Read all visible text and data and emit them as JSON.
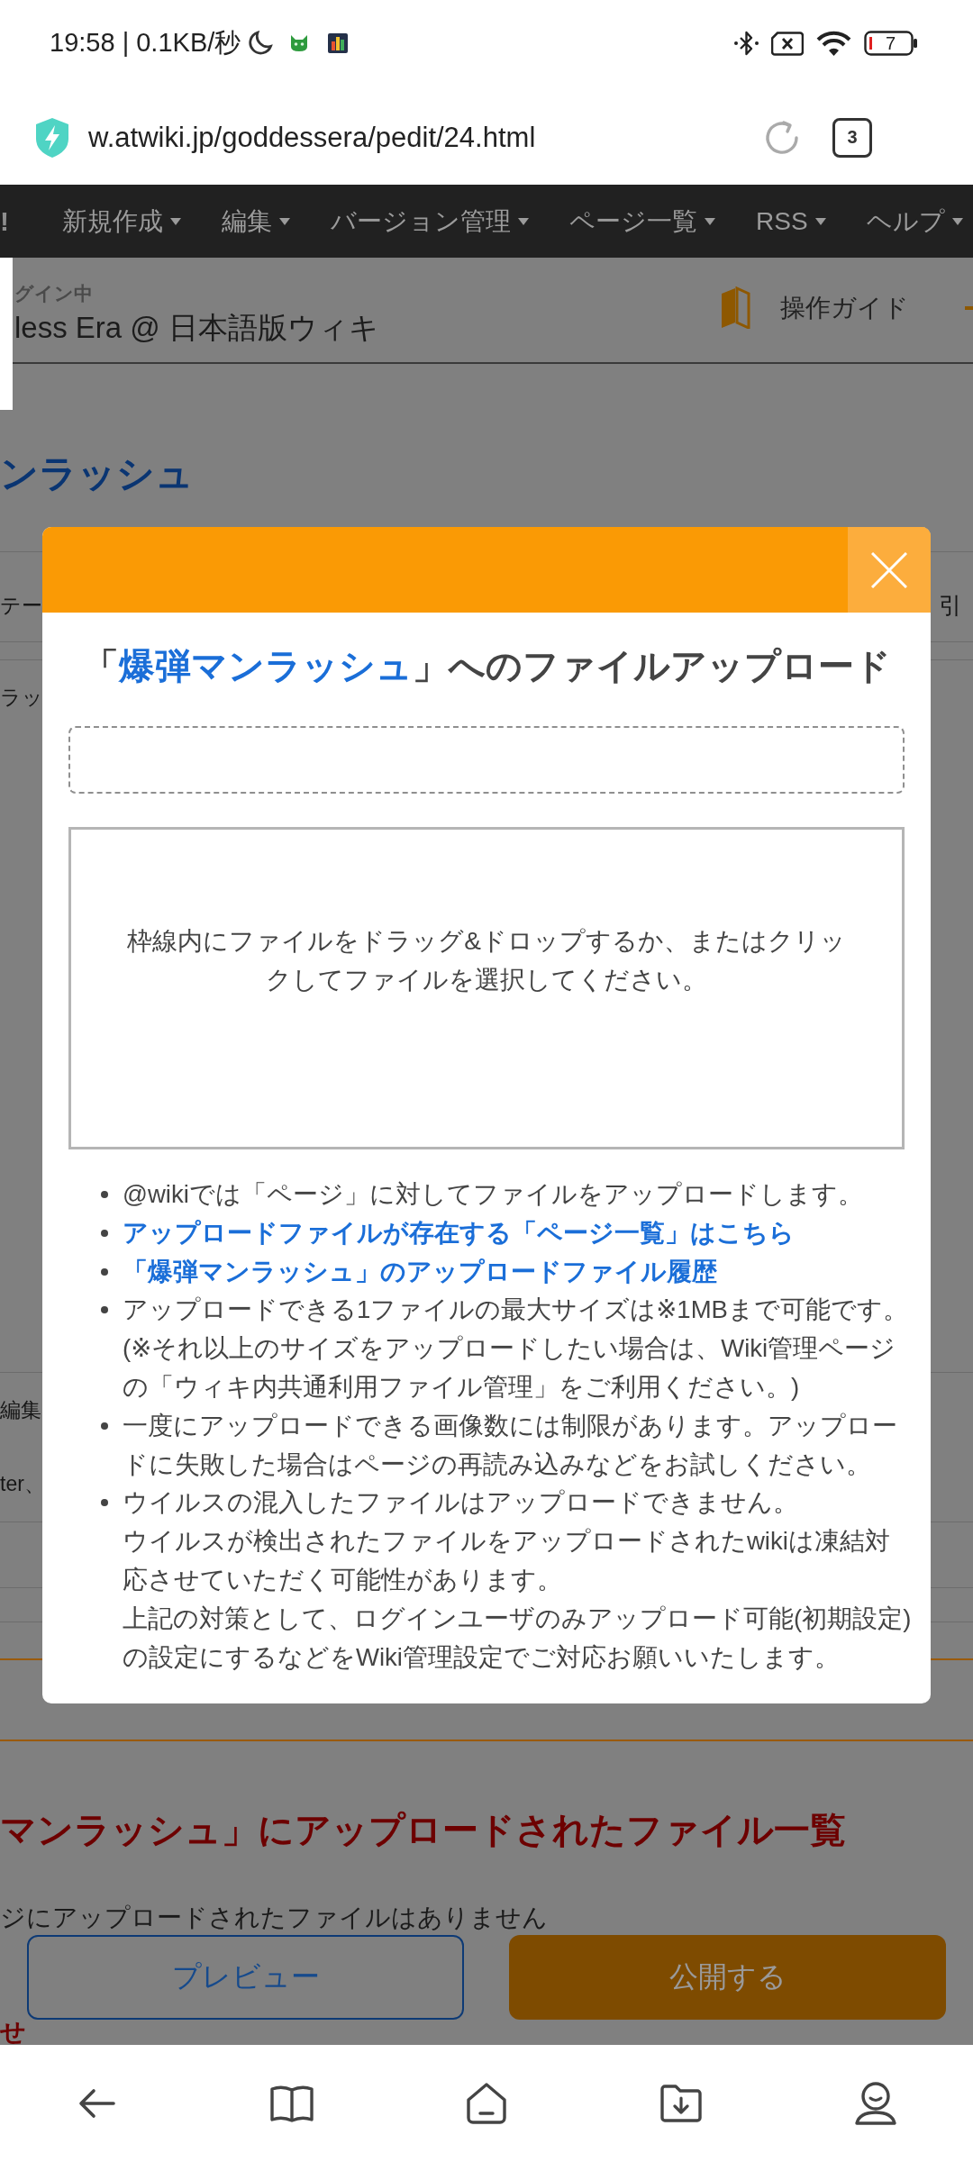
{
  "status_bar": {
    "time_speed": "19:58 | 0.1KB/秒",
    "battery": "7"
  },
  "address_bar": {
    "url": "w.atwiki.jp/goddessera/pedit/24.html",
    "tab_count": "3"
  },
  "site_nav": {
    "logo_fragment": "!",
    "items": [
      {
        "label": "新規作成"
      },
      {
        "label": "編集"
      },
      {
        "label": "バージョン管理"
      },
      {
        "label": "ページ一覧"
      },
      {
        "label": "RSS"
      },
      {
        "label": "ヘルプ"
      }
    ]
  },
  "background_page": {
    "header": {
      "login_status": "グイン中",
      "site_title": "less Era @ 日本語版ウィキ",
      "guide_link": "操作ガイド"
    },
    "page_title": "ンラッシュ",
    "tab_row": {
      "left": "テー",
      "right": "引"
    },
    "row_fragments": {
      "upper": "ラッ",
      "middle": "編集",
      "lower": "ter、"
    },
    "files_heading": "マンラッシュ」にアップロードされたファイル一覧",
    "no_files_text": "ジにアップロードされたファイルはありません",
    "next_heading": "せ"
  },
  "action_buttons": [
    {
      "kind": "outline",
      "label": "プレビュー"
    },
    {
      "kind": "primary",
      "label": "公開する"
    }
  ],
  "upload_dialog": {
    "title": {
      "before": "「",
      "link": "爆弾マンラッシュ",
      "after": "」へのファイルアップロード"
    },
    "drop_zone_text": "枠線内にファイルをドラッグ&ドロップするか、またはクリックしてファイルを選択してください。",
    "notes": [
      {
        "kind": "text",
        "lines": [
          "@wikiでは「ページ」に対してファイルをアップロードします。"
        ]
      },
      {
        "kind": "link",
        "lines": [
          "アップロードファイルが存在する「ページ一覧」はこちら"
        ]
      },
      {
        "kind": "link",
        "lines": [
          "「爆弾マンラッシュ」のアップロードファイル履歴"
        ]
      },
      {
        "kind": "text",
        "lines": [
          "アップロードできる1ファイルの最大サイズは※1MBまで可能です。",
          "(※それ以上のサイズをアップロードしたい場合は、Wiki管理ページの「ウィキ内共通利用ファイル管理」をご利用ください。)"
        ]
      },
      {
        "kind": "text",
        "lines": [
          "一度にアップロードできる画像数には制限があります。アップロードに失敗した場合はページの再読み込みなどをお試しください。"
        ]
      },
      {
        "kind": "text",
        "lines": [
          "ウイルスの混入したファイルはアップロードできません。",
          "ウイルスが検出されたファイルをアップロードされたwikiは凍結対応させていただく可能性があります。",
          "上記の対策として、ログインユーザのみアップロード可能(初期設定)の設定にするなどをWiki管理設定でご対応お願いいたします。"
        ]
      }
    ]
  }
}
